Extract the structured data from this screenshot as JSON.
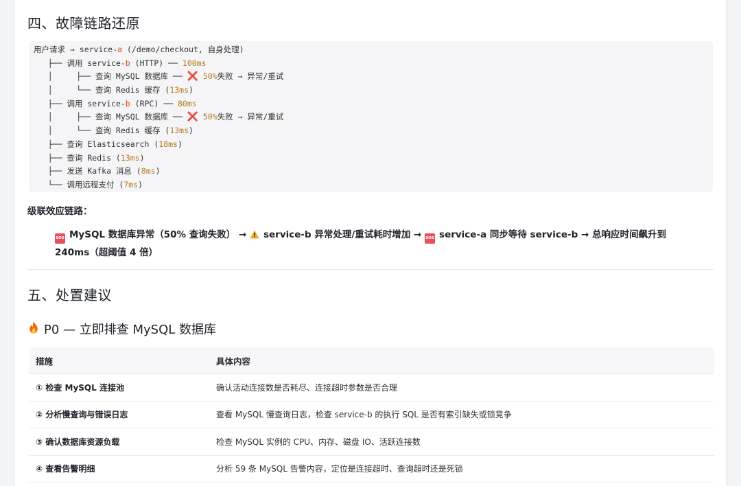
{
  "section4": {
    "title": "四、故障链路还原",
    "code_lines": [
      [
        {
          "t": "用户请求 → service-"
        },
        {
          "t": "a",
          "c": "c-red"
        },
        {
          "t": " (/demo/checkout, 自身处理)"
        }
      ],
      [
        {
          "t": "   ├── 调用 service-"
        },
        {
          "t": "b",
          "c": "c-red"
        },
        {
          "t": " (HTTP) ── "
        },
        {
          "t": "100ms",
          "c": "c-num"
        }
      ],
      [
        {
          "t": "   │     ├── 查询 MySQL 数据库 ── "
        },
        {
          "t": "❌",
          "c": "c-x"
        },
        {
          "t": " "
        },
        {
          "t": "50%",
          "c": "c-num"
        },
        {
          "t": "失败 → 异常/重试"
        }
      ],
      [
        {
          "t": "   │     └── 查询 Redis 缓存 ("
        },
        {
          "t": "13ms",
          "c": "c-num"
        },
        {
          "t": ")"
        }
      ],
      [
        {
          "t": "   ├── 调用 service-"
        },
        {
          "t": "b",
          "c": "c-red"
        },
        {
          "t": " (RPC) ── "
        },
        {
          "t": "80ms",
          "c": "c-num"
        }
      ],
      [
        {
          "t": "   │     ├── 查询 MySQL 数据库 ── "
        },
        {
          "t": "❌",
          "c": "c-x"
        },
        {
          "t": " "
        },
        {
          "t": "50%",
          "c": "c-num"
        },
        {
          "t": "失败 → 异常/重试"
        }
      ],
      [
        {
          "t": "   │     └── 查询 Redis 缓存 ("
        },
        {
          "t": "13ms",
          "c": "c-num"
        },
        {
          "t": ")"
        }
      ],
      [
        {
          "t": "   ├── 查询 Elasticsearch ("
        },
        {
          "t": "18ms",
          "c": "c-num"
        },
        {
          "t": ")"
        }
      ],
      [
        {
          "t": "   ├── 查询 Redis ("
        },
        {
          "t": "13ms",
          "c": "c-num"
        },
        {
          "t": ")"
        }
      ],
      [
        {
          "t": "   ├── 发送 Kafka 消息 ("
        },
        {
          "t": "8ms",
          "c": "c-num"
        },
        {
          "t": ")"
        }
      ],
      [
        {
          "t": "   └── 调用远程支付 ("
        },
        {
          "t": "7ms",
          "c": "c-num"
        },
        {
          "t": ")"
        }
      ]
    ],
    "cascade_heading": "级联效应链路：",
    "cascade": {
      "badge": "SOS",
      "part1": "MySQL 数据库异常（50% 查询失败）",
      "arrow1": " → ",
      "part2": "service-b 异常处理/重试耗时增加",
      "arrow2": " → ",
      "part3": "service-a 同步等待 service-b → 总响应时间飙升到 240ms（超阈值 4 倍）"
    }
  },
  "section5": {
    "title": "五、处置建议",
    "p0_title": "P0 — 立即排查 MySQL 数据库",
    "table": {
      "headers": [
        "措施",
        "具体内容"
      ],
      "rows": [
        [
          "① 检查 MySQL 连接池",
          "确认活动连接数是否耗尽、连接超时参数是否合理"
        ],
        [
          "② 分析慢查询与错误日志",
          "查看 MySQL 慢查询日志，检查 service-b 的执行 SQL 是否有索引缺失或锁竞争"
        ],
        [
          "③ 确认数据库资源负载",
          "检查 MySQL 实例的 CPU、内存、磁盘 IO、活跃连接数"
        ],
        [
          "④ 查看告警明细",
          "分析 59 条 MySQL 告警内容，定位是连接超时、查询超时还是死锁"
        ]
      ]
    }
  },
  "icons": {
    "sos": "sos-icon",
    "warning": "warning-icon",
    "fire": "fire-icon",
    "error": "cross-mark-icon"
  },
  "colors": {
    "service_letter": "#d9480f",
    "duration": "#b7791f",
    "error_mark": "#e03131",
    "sos_badge": "#e8505b",
    "warning": "#f5a623"
  }
}
